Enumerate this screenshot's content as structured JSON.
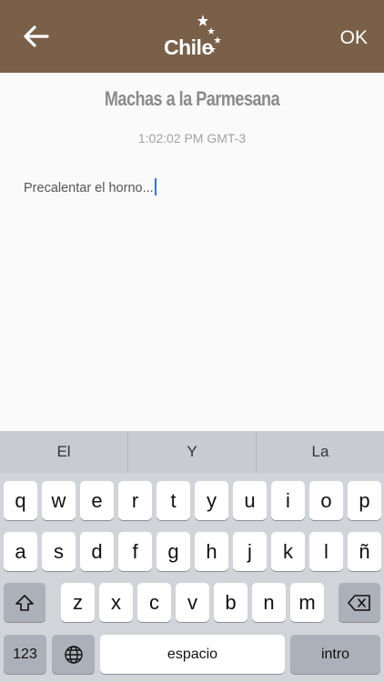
{
  "header": {
    "logo_text": "Chile",
    "ok_label": "OK",
    "bg_color": "#7a6048"
  },
  "note": {
    "title": "Machas a la Parmesana",
    "time": "1:02:02 PM GMT-3",
    "body": "Precalentar el horno..."
  },
  "keyboard": {
    "suggestions": [
      "El",
      "Y",
      "La"
    ],
    "row1": [
      "q",
      "w",
      "e",
      "r",
      "t",
      "y",
      "u",
      "i",
      "o",
      "p"
    ],
    "row2": [
      "a",
      "s",
      "d",
      "f",
      "g",
      "h",
      "j",
      "k",
      "l",
      "ñ"
    ],
    "row3": [
      "z",
      "x",
      "c",
      "v",
      "b",
      "n",
      "m"
    ],
    "numbers_label": "123",
    "space_label": "espacio",
    "return_label": "intro",
    "icons": [
      "shift-icon",
      "backspace-icon",
      "globe-icon"
    ]
  }
}
